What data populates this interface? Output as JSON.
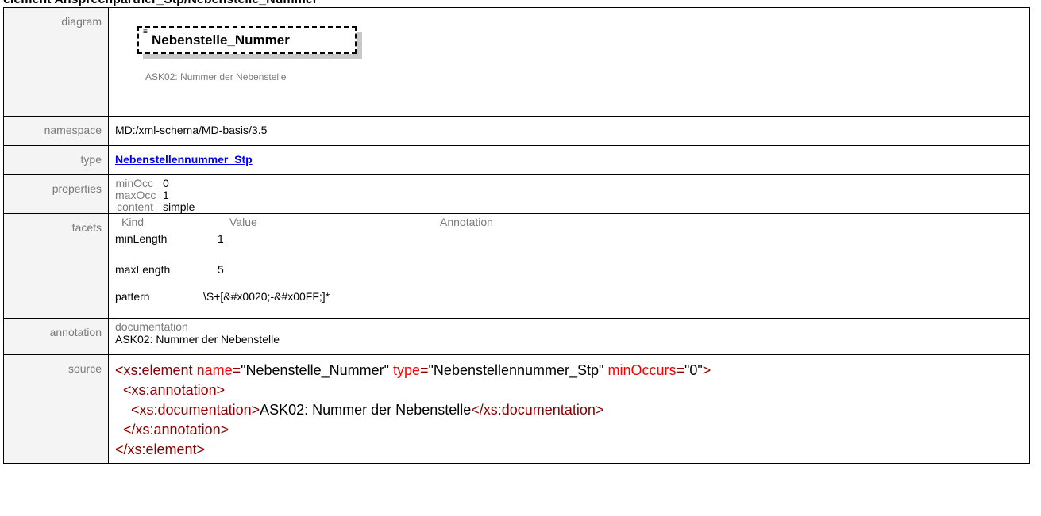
{
  "heading": "element Ansprechpartner_Stp/Nebenstelle_Nummer",
  "rows": {
    "diagram": {
      "label": "diagram",
      "glyph": "≡",
      "element_name": "Nebenstelle_Nummer",
      "documentation": "ASK02: Nummer der Nebenstelle"
    },
    "namespace": {
      "label": "namespace",
      "value": "MD:/xml-schema/MD-basis/3.5"
    },
    "type": {
      "label": "type",
      "value": "Nebenstellennummer_Stp"
    },
    "properties": {
      "label": "properties",
      "items": [
        {
          "key": "minOcc",
          "value": "0"
        },
        {
          "key": "maxOcc",
          "value": "1"
        },
        {
          "key": "content",
          "value": "simple"
        }
      ]
    },
    "facets": {
      "label": "facets",
      "headers": [
        "Kind",
        "Value",
        "Annotation"
      ],
      "items": [
        {
          "kind": "minLength",
          "value": "1",
          "annotation": ""
        },
        {
          "kind": "maxLength",
          "value": "5",
          "annotation": ""
        },
        {
          "kind": "pattern",
          "value": "\\S+[&#x0020;-&#x00FF;]*",
          "annotation": ""
        }
      ]
    },
    "annotation": {
      "label": "annotation",
      "key": "documentation",
      "value": "ASK02: Nummer der Nebenstelle"
    },
    "source": {
      "label": "source",
      "line1_open": "<xs:element",
      "line1_attr1": "name",
      "line1_val1": "\"Nebenstelle_Nummer\"",
      "line1_attr2": "type",
      "line1_val2": "\"Nebenstellennummer_Stp\"",
      "line1_attr3": "minOccurs",
      "line1_val3": "\"0\"",
      "line1_close": ">",
      "line2": "<xs:annotation>",
      "line3_open": "<xs:documentation>",
      "line3_text": "ASK02: Nummer der Nebenstelle",
      "line3_close": "</xs:documentation>",
      "line4": "</xs:annotation>",
      "line5": "</xs:element>",
      "eq": "="
    }
  },
  "colors": {
    "label_text": "#7a7a7a",
    "label_bg": "#f4f4f4",
    "link": "#0000ee",
    "xml_tag": "#8b0000",
    "xml_attr": "#ff0000"
  }
}
